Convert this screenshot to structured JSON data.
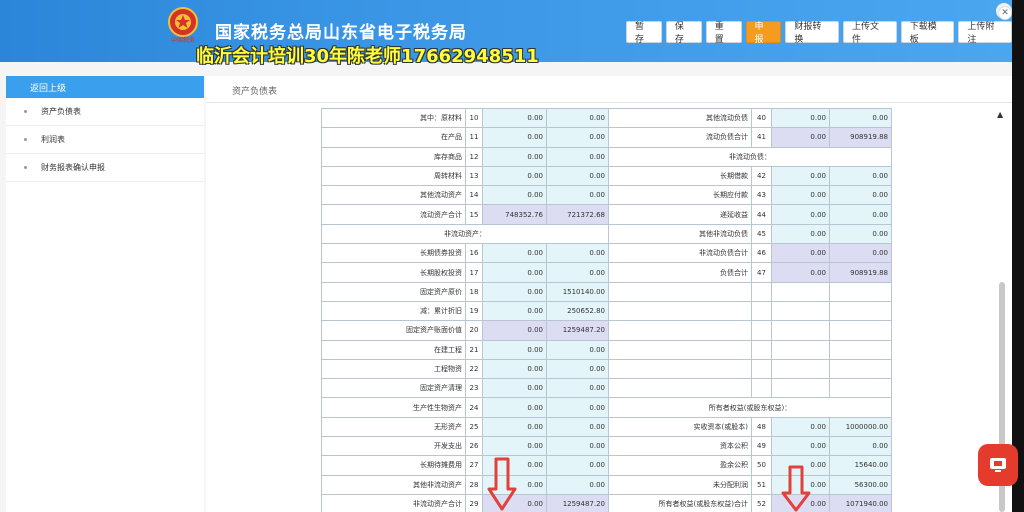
{
  "header": {
    "title": "国家税务总局山东省电子税务局",
    "emblem_text": "中国税务",
    "watermark": "临沂会计培训30年陈老师17662948511",
    "toolbar": [
      {
        "label": "暂存",
        "active": false
      },
      {
        "label": "保存",
        "active": false
      },
      {
        "label": "重置",
        "active": false
      },
      {
        "label": "申报",
        "active": true
      },
      {
        "label": "财报转换",
        "active": false
      },
      {
        "label": "上传文件",
        "active": false
      },
      {
        "label": "下载模板",
        "active": false
      },
      {
        "label": "上传附注",
        "active": false
      }
    ],
    "close_icon": "✕"
  },
  "sidebar": {
    "back_label": "返回上级",
    "items": [
      {
        "label": "资产负债表"
      },
      {
        "label": "利润表"
      },
      {
        "label": "财务报表确认申报"
      }
    ]
  },
  "main": {
    "breadcrumb": "资产负债表",
    "scroll_up_icon": "▲"
  },
  "sheet": {
    "rows": [
      {
        "l": {
          "label": "其中：原材料",
          "line": "10",
          "a": "0.00",
          "b": "0.00",
          "ta": "inp",
          "tb": "inp"
        },
        "r": {
          "label": "其他流动负债",
          "line": "40",
          "a": "0.00",
          "b": "0.00",
          "ta": "inp",
          "tb": "inp"
        }
      },
      {
        "l": {
          "label": "在产品",
          "line": "11",
          "a": "0.00",
          "b": "0.00",
          "ta": "inp",
          "tb": "inp"
        },
        "r": {
          "label": "流动负债合计",
          "line": "41",
          "a": "0.00",
          "b": "908919.88",
          "ta": "calc",
          "tb": "calc"
        }
      },
      {
        "l": {
          "label": "库存商品",
          "line": "12",
          "a": "0.00",
          "b": "0.00",
          "ta": "inp",
          "tb": "inp"
        },
        "r": {
          "section": "非流动负债："
        }
      },
      {
        "l": {
          "label": "周转材料",
          "line": "13",
          "a": "0.00",
          "b": "0.00",
          "ta": "inp",
          "tb": "inp"
        },
        "r": {
          "label": "长期借款",
          "line": "42",
          "a": "0.00",
          "b": "0.00",
          "ta": "inp",
          "tb": "inp"
        }
      },
      {
        "l": {
          "label": "其他流动资产",
          "line": "14",
          "a": "0.00",
          "b": "0.00",
          "ta": "inp",
          "tb": "inp"
        },
        "r": {
          "label": "长期应付款",
          "line": "43",
          "a": "0.00",
          "b": "0.00",
          "ta": "inp",
          "tb": "inp"
        }
      },
      {
        "l": {
          "label": "流动资产合计",
          "line": "15",
          "a": "748352.76",
          "b": "721372.68",
          "ta": "calc",
          "tb": "calc"
        },
        "r": {
          "label": "递延收益",
          "line": "44",
          "a": "0.00",
          "b": "0.00",
          "ta": "inp",
          "tb": "inp"
        }
      },
      {
        "l": {
          "section": "非流动资产："
        },
        "r": {
          "label": "其他非流动负债",
          "line": "45",
          "a": "0.00",
          "b": "0.00",
          "ta": "inp",
          "tb": "inp"
        }
      },
      {
        "l": {
          "label": "长期债券投资",
          "line": "16",
          "a": "0.00",
          "b": "0.00",
          "ta": "inp",
          "tb": "inp"
        },
        "r": {
          "label": "非流动负债合计",
          "line": "46",
          "a": "0.00",
          "b": "0.00",
          "ta": "calc",
          "tb": "calc"
        }
      },
      {
        "l": {
          "label": "长期股权投资",
          "line": "17",
          "a": "0.00",
          "b": "0.00",
          "ta": "inp",
          "tb": "inp"
        },
        "r": {
          "label": "负债合计",
          "line": "47",
          "a": "0.00",
          "b": "908919.88",
          "ta": "calc",
          "tb": "calc"
        }
      },
      {
        "l": {
          "label": "固定资产原价",
          "line": "18",
          "a": "0.00",
          "b": "1510140.00",
          "ta": "inp",
          "tb": "inp"
        },
        "r": {
          "blank": true
        }
      },
      {
        "l": {
          "label": "减：累计折旧",
          "line": "19",
          "a": "0.00",
          "b": "250652.80",
          "ta": "inp",
          "tb": "inp"
        },
        "r": {
          "blank": true
        }
      },
      {
        "l": {
          "label": "固定资产账面价值",
          "line": "20",
          "a": "0.00",
          "b": "1259487.20",
          "ta": "calc",
          "tb": "calc"
        },
        "r": {
          "blank": true
        }
      },
      {
        "l": {
          "label": "在建工程",
          "line": "21",
          "a": "0.00",
          "b": "0.00",
          "ta": "inp",
          "tb": "inp"
        },
        "r": {
          "blank": true
        }
      },
      {
        "l": {
          "label": "工程物资",
          "line": "22",
          "a": "0.00",
          "b": "0.00",
          "ta": "inp",
          "tb": "inp"
        },
        "r": {
          "blank": true
        }
      },
      {
        "l": {
          "label": "固定资产清理",
          "line": "23",
          "a": "0.00",
          "b": "0.00",
          "ta": "inp",
          "tb": "inp"
        },
        "r": {
          "blank": true
        }
      },
      {
        "l": {
          "label": "生产性生物资产",
          "line": "24",
          "a": "0.00",
          "b": "0.00",
          "ta": "inp",
          "tb": "inp"
        },
        "r": {
          "section": "所有者权益(或股东权益)："
        }
      },
      {
        "l": {
          "label": "无形资产",
          "line": "25",
          "a": "0.00",
          "b": "0.00",
          "ta": "inp",
          "tb": "inp"
        },
        "r": {
          "label": "实收资本(或股本)",
          "line": "48",
          "a": "0.00",
          "b": "1000000.00",
          "ta": "inp",
          "tb": "inp"
        }
      },
      {
        "l": {
          "label": "开发支出",
          "line": "26",
          "a": "0.00",
          "b": "0.00",
          "ta": "inp",
          "tb": "inp"
        },
        "r": {
          "label": "资本公积",
          "line": "49",
          "a": "0.00",
          "b": "0.00",
          "ta": "inp",
          "tb": "inp"
        }
      },
      {
        "l": {
          "label": "长期待摊费用",
          "line": "27",
          "a": "0.00",
          "b": "0.00",
          "ta": "inp",
          "tb": "inp"
        },
        "r": {
          "label": "盈余公积",
          "line": "50",
          "a": "0.00",
          "b": "15640.00",
          "ta": "inp",
          "tb": "inp"
        }
      },
      {
        "l": {
          "label": "其他非流动资产",
          "line": "28",
          "a": "0.00",
          "b": "0.00",
          "ta": "inp",
          "tb": "inp"
        },
        "r": {
          "label": "未分配利润",
          "line": "51",
          "a": "0.00",
          "b": "56300.00",
          "ta": "inp",
          "tb": "inp"
        }
      },
      {
        "l": {
          "label": "非流动资产合计",
          "line": "29",
          "a": "0.00",
          "b": "1259487.20",
          "ta": "calc",
          "tb": "calc"
        },
        "r": {
          "label": "所有者权益(或股东权益)合计",
          "line": "52",
          "a": "0.00",
          "b": "1071940.00",
          "ta": "calc",
          "tb": "calc"
        }
      }
    ]
  },
  "colors": {
    "header": "#3b97e6",
    "active_button": "#f39c1f",
    "input_cell": "#e3f5f8",
    "calc_cell": "#dcdcf2",
    "annotation_arrow": "#e0413a"
  }
}
